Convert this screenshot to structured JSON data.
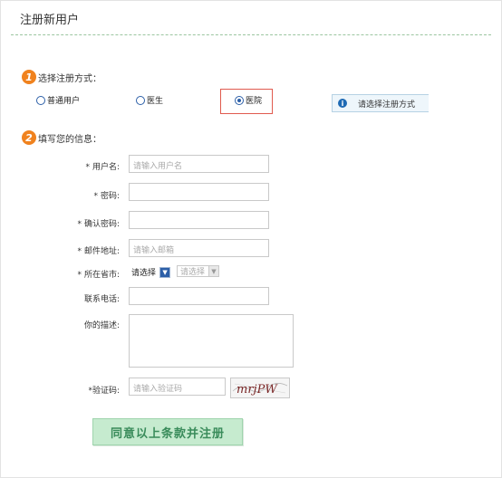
{
  "page": {
    "title": "注册新用户"
  },
  "step1": {
    "number": "1",
    "label": "选择注册方式："
  },
  "register_types": [
    {
      "label": "普通用户",
      "selected": false
    },
    {
      "label": "医生",
      "selected": false
    },
    {
      "label": "医院",
      "selected": true
    }
  ],
  "hint": {
    "icon": "info-icon",
    "text": "请选择注册方式"
  },
  "step2": {
    "number": "2",
    "label": "填写您的信息："
  },
  "form": {
    "username": {
      "label": "用户名:",
      "star": "*",
      "placeholder": "请输入用户名"
    },
    "password": {
      "label": "密码:",
      "star": "*"
    },
    "confirm": {
      "label": "确认密码:",
      "star": "*"
    },
    "email": {
      "label": "邮件地址:",
      "star": "*",
      "placeholder": "请输入邮箱"
    },
    "region": {
      "label": "所在省市:",
      "star": "*",
      "province": "请选择",
      "city": "请选择"
    },
    "phone": {
      "label": "联系电话:"
    },
    "description": {
      "label": "你的描述:"
    },
    "captcha": {
      "label": "*验证码:",
      "placeholder": "请输入验证码",
      "image_text": "mrjPW"
    }
  },
  "submit_label": "同意以上条款并注册",
  "colors": {
    "accent_orange": "#f0821e",
    "highlight_red": "#e05a4e",
    "button_green": "#c6ebcf"
  }
}
